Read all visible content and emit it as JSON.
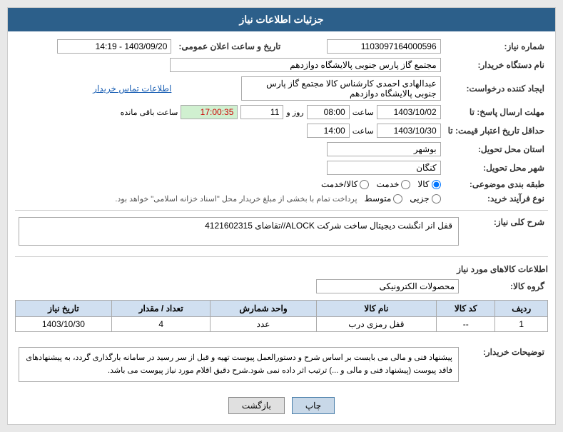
{
  "header": {
    "title": "جزئیات اطلاعات نیاز"
  },
  "fields": {
    "shomara_niaz_label": "شماره نیاز:",
    "shomara_niaz_value": "1103097164000596",
    "naam_dastgah_label": "نام دستگاه خریدار:",
    "naam_dastgah_value": "مجتمع گاز پارس جنوبی  پالایشگاه دوازدهم",
    "ijad_label": "ایجاد کننده درخواست:",
    "ijad_value": "عبدالهادی احمدی کارشناس کالا مجتمع گاز پارس جنوبی  پالایشگاه دوازدهم",
    "ettelaat_tamas": "اطلاعات تماس خریدار",
    "tarikh_label": "تاریخ و ساعت اعلان عمومی:",
    "tarikh_value": "1403/09/20 - 14:19",
    "mohlat_label": "مهلت ارسال پاسخ: تا",
    "mohlat_date": "1403/10/02",
    "mohlat_saat": "08:00",
    "mohlat_rooz": "11",
    "mohlat_remaining": "17:00:35",
    "mohlat_remaining_label": "ساعت باقی مانده",
    "hadaghal_label": "حداقل تاریخ اعتبار قیمت: تا",
    "hadaghal_date": "1403/10/30",
    "hadaghal_saat": "14:00",
    "ostan_label": "استان محل تحویل:",
    "ostan_value": "بوشهر",
    "shahr_label": "شهر محل تحویل:",
    "shahr_value": "کنگان",
    "tabagheh_label": "طبقه بندی موضوعی:",
    "tabagheh_options": [
      "کالا",
      "خدمت",
      "کالا/خدمت"
    ],
    "tabagheh_selected": "کالا",
    "nooe_farayand_label": "نوع فرآیند خرید:",
    "nooe_farayand_options": [
      "جزیی",
      "متوسط"
    ],
    "nooe_farayand_desc": "پرداخت تمام با بخشی از مبلغ خریدار محل \"اسناد خزانه اسلامی\" خواهد بود.",
    "sarh_label": "شرح کلی نیاز:",
    "sarh_value": "قفل انر انگشت دیجیتال ساخت شرکت ALOCK//تقاضای 4121602315",
    "ettelaat_section": "اطلاعات کالاهای مورد نیاز",
    "grooh_label": "گروه کالا:",
    "grooh_value": "محصولات الکترونیکی",
    "table": {
      "headers": [
        "ردیف",
        "کد کالا",
        "نام کالا",
        "واحد شمارش",
        "تعداد / مقدار",
        "تاریخ نیاز"
      ],
      "rows": [
        [
          "1",
          "--",
          "قفل رمزی درب",
          "عدد",
          "4",
          "1403/10/30"
        ]
      ]
    },
    "notice_label": "توضیحات خریدار:",
    "notice_text": "پیشنهاد فنی و مالی می بایست بر اساس شرح و دستورالعمل پیوست تهیه و قبل از سر رسید در سامانه بارگذاری گردد، به پیشنهادهای فاقد پیوست (پیشنهاد فنی و مالی و ...) ترتیب اثر داده نمی شود.شرح دقیق اقلام مورد نیاز پیوست می باشد.",
    "btn_chap": "چاپ",
    "btn_bazgasht": "بازگشت"
  }
}
